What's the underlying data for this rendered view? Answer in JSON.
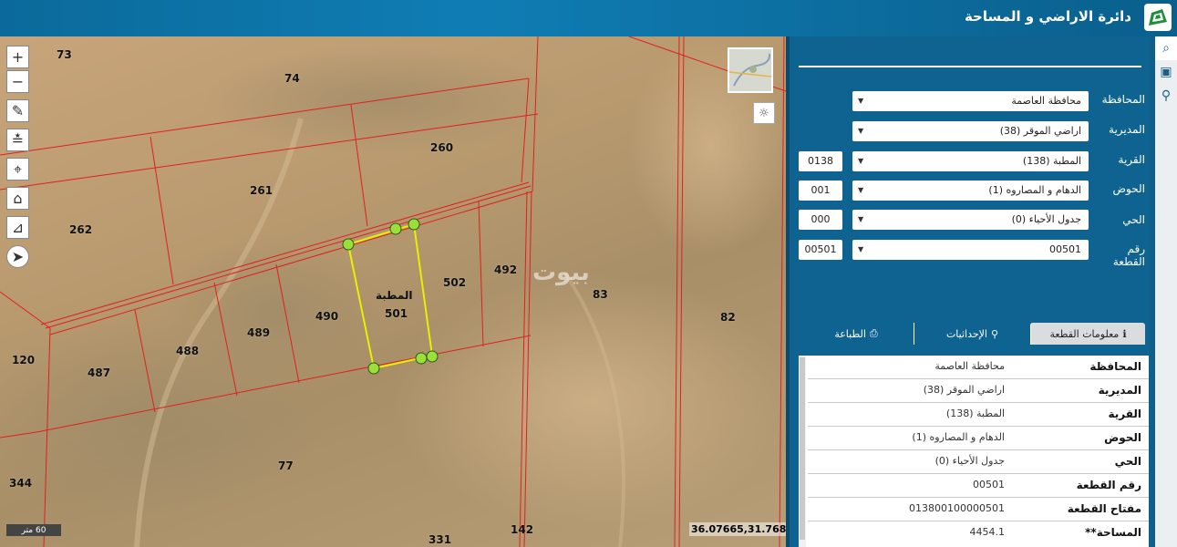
{
  "header": {
    "title": "دائرة الاراضي و المساحة",
    "logo_icon": "land-department-logo-icon"
  },
  "map": {
    "tools": [
      "zoom-in-icon",
      "zoom-out-icon",
      "pencil-icon",
      "measure-icon",
      "locate-icon",
      "home-icon",
      "chart-icon",
      "compass-icon"
    ],
    "zoom_in": "+",
    "zoom_out": "−",
    "scale": "60 متر",
    "coordinates": "36.07665,31.76810",
    "selected_parcel_name": "المطبة",
    "watermark": "بيوت",
    "parcel_numbers": [
      {
        "id": "p73",
        "text": "73"
      },
      {
        "id": "p74",
        "text": "74"
      },
      {
        "id": "p260",
        "text": "260"
      },
      {
        "id": "p261",
        "text": "261"
      },
      {
        "id": "p262",
        "text": "262"
      },
      {
        "id": "p492",
        "text": "492"
      },
      {
        "id": "p502",
        "text": "502"
      },
      {
        "id": "p83",
        "text": "83"
      },
      {
        "id": "p82",
        "text": "82"
      },
      {
        "id": "p501",
        "text": "501"
      },
      {
        "id": "p490",
        "text": "490"
      },
      {
        "id": "p489",
        "text": "489"
      },
      {
        "id": "p488",
        "text": "488"
      },
      {
        "id": "p487",
        "text": "487"
      },
      {
        "id": "p120",
        "text": "120"
      },
      {
        "id": "p77",
        "text": "77"
      },
      {
        "id": "p344",
        "text": "344"
      },
      {
        "id": "p142",
        "text": "142"
      },
      {
        "id": "p331",
        "text": "331"
      }
    ]
  },
  "search_form": {
    "governorate": {
      "label": "المحافظة",
      "value": "محافظة العاصمة"
    },
    "directorate": {
      "label": "المديرية",
      "value": "اراضي الموقر (38)"
    },
    "village": {
      "label": "القرية",
      "value": "المطبة (138)",
      "code": "0138"
    },
    "basin": {
      "label": "الحوض",
      "value": "الدهام و المصاروه (1)",
      "code": "001"
    },
    "district": {
      "label": "الحي",
      "value": "جدول الأحياء (0)",
      "code": "000"
    },
    "parcel": {
      "label": "رقم القطعة",
      "value": "00501",
      "code": "00501"
    }
  },
  "tabs": [
    {
      "label": "معلومات القطعة",
      "icon": "info-icon",
      "active": true
    },
    {
      "label": "الإحداثيات",
      "icon": "person-pin-icon",
      "active": false
    },
    {
      "label": "الطباعة",
      "icon": "print-icon",
      "active": false
    }
  ],
  "parcel_info": [
    {
      "label": "المحافظة",
      "value": "محافظة العاصمة"
    },
    {
      "label": "المديرية",
      "value": "اراضي الموقر (38)"
    },
    {
      "label": "القرية",
      "value": "المطبة (138)"
    },
    {
      "label": "الحوض",
      "value": "الدهام و المصاروه (1)"
    },
    {
      "label": "الحي",
      "value": "جدول الأحياء (0)"
    },
    {
      "label": "رقم القطعة",
      "value": "00501"
    },
    {
      "label": "مفتاح القطعة",
      "value": "013800100000501"
    },
    {
      "label": "المساحة**",
      "value": "4454.1"
    }
  ],
  "side_icons": [
    "search-icon",
    "map-layers-icon",
    "location-pin-icon"
  ],
  "colors": {
    "header": "#0f7db4",
    "panel": "#0f6390",
    "parcel_line": "#e02020",
    "selected_outline": "#e8f000",
    "vertex": "#9be03a"
  }
}
